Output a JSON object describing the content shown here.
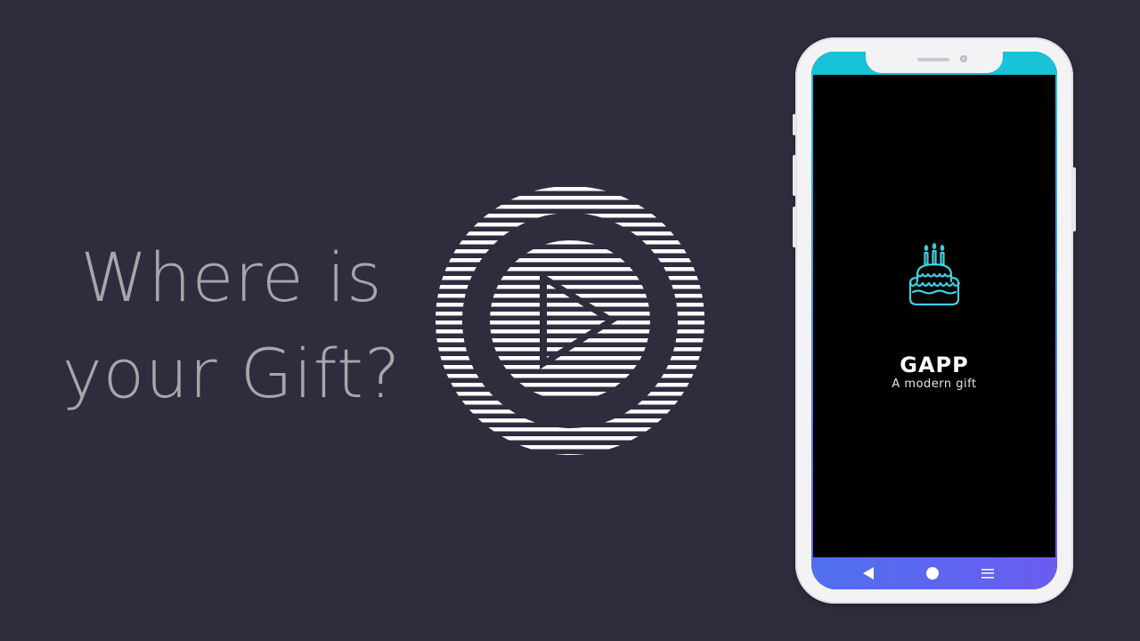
{
  "headline": {
    "line1": "Where is",
    "line2": "your Gift?"
  },
  "play_icon": "play-icon",
  "phone": {
    "app_logo_icon": "birthday-cake-icon",
    "app_title": "GAPP",
    "app_subtitle": "A modern gift",
    "nav": {
      "back_icon": "back-triangle-icon",
      "home_icon": "home-circle-icon",
      "menu_icon": "menu-lines-icon"
    }
  },
  "colors": {
    "background": "#2f2c3e",
    "headline_text": "#a7a6ab",
    "status_bar": "#19c1d9",
    "nav_bar_start": "#4f70ee",
    "nav_bar_end": "#6a5cf0",
    "logo_stroke": "#3fd0e0"
  }
}
